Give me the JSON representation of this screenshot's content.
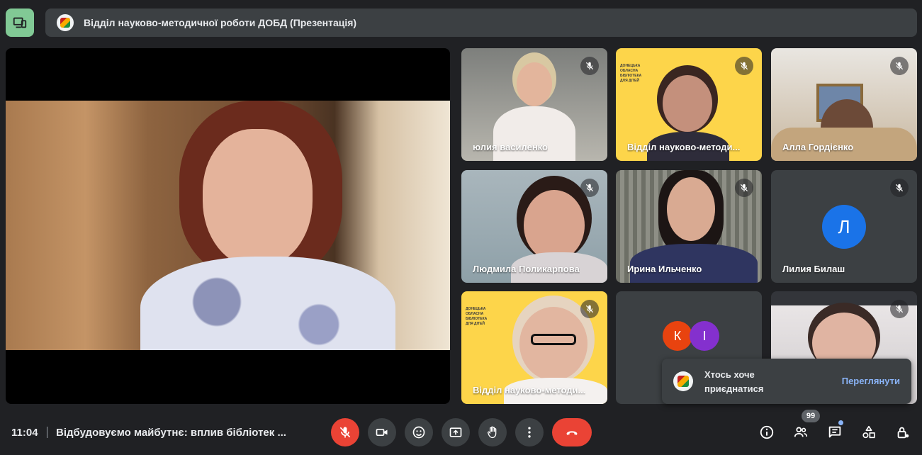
{
  "top_bar": {
    "title": "Відділ науково-методичної роботи ДОБД (Презентація)"
  },
  "tiles": [
    {
      "name": "юлия василенко",
      "muted": true
    },
    {
      "name": "Відділ науково-методи...",
      "muted": true
    },
    {
      "name": "Алла Гордієнко",
      "muted": true
    },
    {
      "name": "Людмила Поликарпова",
      "muted": true
    },
    {
      "name": "Ирина Ильченко",
      "muted": true
    },
    {
      "name": "Лилия Билаш",
      "avatar_letter": "Л",
      "avatar_color": "#1a73e8",
      "muted": true
    },
    {
      "name": "Відділ науково-методи...",
      "muted": true
    },
    {
      "avatars": [
        {
          "letter": "К",
          "color": "#e8430f"
        },
        {
          "letter": "І",
          "color": "#8430ce"
        }
      ]
    },
    {
      "muted": true
    }
  ],
  "brand_logo_lines": [
    "ДОНЕЦЬКА",
    "ОБЛАСНА",
    "БІБЛІОТЕКА",
    "ДЛЯ ДІТЕЙ"
  ],
  "toast": {
    "message": "Хтось хоче приєднатися",
    "action": "Переглянути"
  },
  "bottom_bar": {
    "time": "11:04",
    "meeting_name": "Відбудовуємо майбутнє: вплив бібліотек ...",
    "participants_count": "99"
  },
  "colors": {
    "background": "#202124",
    "surface": "#3c4043",
    "present_accent": "#81c995",
    "danger": "#ea4335",
    "link": "#8ab4f8"
  },
  "icons": {
    "present": "present-to-all-icon",
    "mute": "mic-off-icon",
    "camera": "videocam-icon",
    "emoji": "emoji-icon",
    "share": "present-screen-icon",
    "hand": "raise-hand-icon",
    "more": "more-vert-icon",
    "leave": "call-end-icon",
    "info": "info-icon",
    "people": "people-icon",
    "chat": "chat-icon",
    "activities": "activities-icon",
    "host": "host-controls-icon"
  }
}
